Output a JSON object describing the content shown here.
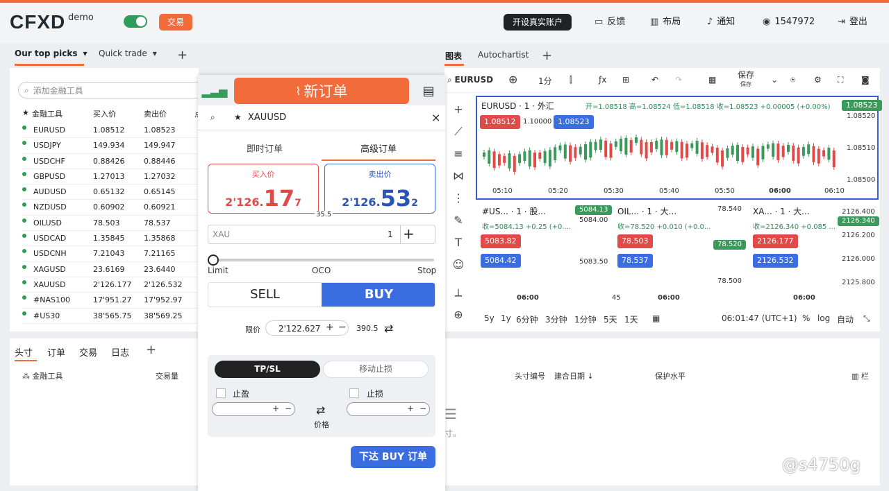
{
  "header": {
    "logo": "CFXD",
    "logo_sub": "demo",
    "trade_badge": "交易",
    "open_account": "开设真实账户",
    "feedback": "反馈",
    "layout": "布局",
    "notify": "通知",
    "account": "1547972",
    "logout": "登出"
  },
  "left_tabs": {
    "tab1": "Our top picks",
    "tab2": "Quick trade"
  },
  "watchlist": {
    "search_placeholder": "添加金融工具",
    "col_instrument": "金融工具",
    "col_bid": "买入价",
    "col_ask": "卖出价",
    "col_extra": "点",
    "rows": [
      {
        "sym": "EURUSD",
        "bid": "1.08512",
        "ask": "1.08523"
      },
      {
        "sym": "USDJPY",
        "bid": "149.934",
        "ask": "149.947"
      },
      {
        "sym": "USDCHF",
        "bid": "0.88426",
        "ask": "0.88446"
      },
      {
        "sym": "GBPUSD",
        "bid": "1.27013",
        "ask": "1.27032"
      },
      {
        "sym": "AUDUSD",
        "bid": "0.65132",
        "ask": "0.65145"
      },
      {
        "sym": "NZDUSD",
        "bid": "0.60902",
        "ask": "0.60921"
      },
      {
        "sym": "OILUSD",
        "bid": "78.503",
        "ask": "78.537"
      },
      {
        "sym": "USDCAD",
        "bid": "1.35845",
        "ask": "1.35868"
      },
      {
        "sym": "USDCNH",
        "bid": "7.21043",
        "ask": "7.21165"
      },
      {
        "sym": "XAGUSD",
        "bid": "23.6169",
        "ask": "23.6440"
      },
      {
        "sym": "XAUUSD",
        "bid": "2'126.177",
        "ask": "2'126.532"
      },
      {
        "sym": "#NAS100",
        "bid": "17'951.27",
        "ask": "17'952.97"
      },
      {
        "sym": "#US30",
        "bid": "38'565.75",
        "ask": "38'569.25"
      }
    ]
  },
  "bottom": {
    "tabs": [
      "头寸",
      "订单",
      "交易",
      "日志"
    ],
    "col_instrument": "金融工具",
    "col_volume": "交易量",
    "col_position_id": "头寸编号",
    "col_open_date": "建合日期",
    "col_protect": "保护水平",
    "col_columns": "栏",
    "empty_text": "寸。"
  },
  "chart_tabs": {
    "tab1": "图表",
    "tab2": "Autochartist"
  },
  "chart_toolbar": {
    "symbol": "EURUSD",
    "interval": "1分",
    "save": "保存",
    "save_sub": "保存"
  },
  "main_chart": {
    "title": "EURUSD · 1 · 外汇",
    "ohlc": "开=1.08518 高=1.08524 低=1.08518 收=1.08523 +0.00005 (+0.00%)",
    "bid": "1.08512",
    "spread": "1.10000",
    "ask": "1.08523",
    "last": "1.08523",
    "y_labels": [
      "1.08520",
      "1.08510",
      "1.08500"
    ],
    "x_labels": [
      "05:10",
      "05:20",
      "05:30",
      "05:40",
      "05:50",
      "06:00",
      "06:10"
    ]
  },
  "mini1": {
    "title": "#US... · 1 · 股...",
    "close": "收=5084.13 +0.25 (+0....",
    "last": "5084.13",
    "y1": "5084.00",
    "y2": "5083.50",
    "bid": "5083.82",
    "ask": "5084.42",
    "x": "06:00"
  },
  "mini2": {
    "title": "OIL... · 1 · 大...",
    "close": "收=78.520 +0.010 (+0.0...",
    "y_top": "78.540",
    "last": "78.520",
    "y_bottom": "78.500",
    "bid": "78.503",
    "ask": "78.537",
    "x_prev": "45",
    "x": "06:00"
  },
  "mini3": {
    "title": "XA... · 1 · 大...",
    "close": "收=2126.340 +0.085 ...",
    "y1": "2126.400",
    "last": "2126.340",
    "y2": "2126.200",
    "y3": "2126.000",
    "y4": "2125.800",
    "bid": "2126.177",
    "ask": "2126.532",
    "x": "06:00"
  },
  "chart_bottom": {
    "ranges": [
      "5y",
      "1y",
      "6分钟",
      "3分钟",
      "1分钟",
      "5天",
      "1天"
    ],
    "clock": "06:01:47 (UTC+1)",
    "pct": "%",
    "log": "log",
    "auto": "自动"
  },
  "order": {
    "title": "新订单",
    "symbol": "XAUUSD",
    "tab_instant": "即时订单",
    "tab_advanced": "高级订单",
    "buy_label": "买入价",
    "sell_label": "卖出价",
    "bid_pre": "2'126.",
    "bid_big": "17",
    "bid_sub": "7",
    "ask_pre": "2'126.",
    "ask_big": "53",
    "ask_sub": "2",
    "spread": "35.5",
    "unit": "XAU",
    "qty": "1",
    "slider_left": "Limit",
    "slider_mid": "OCO",
    "slider_right": "Stop",
    "sell": "SELL",
    "buy": "BUY",
    "limit_label": "限价",
    "limit_value": "2'122.627",
    "distance": "390.5",
    "tpsl_active": "TP/SL",
    "tpsl_trailing": "移动止损",
    "take_profit": "止盈",
    "stop_loss": "止损",
    "price_label": "价格",
    "submit": "下达 BUY 订单"
  },
  "watermark": "@s4750g",
  "colors": {
    "accent": "#f26b3a",
    "buy": "#3a6ee0",
    "sell": "#e24a4a",
    "up": "#3a9a5c"
  }
}
